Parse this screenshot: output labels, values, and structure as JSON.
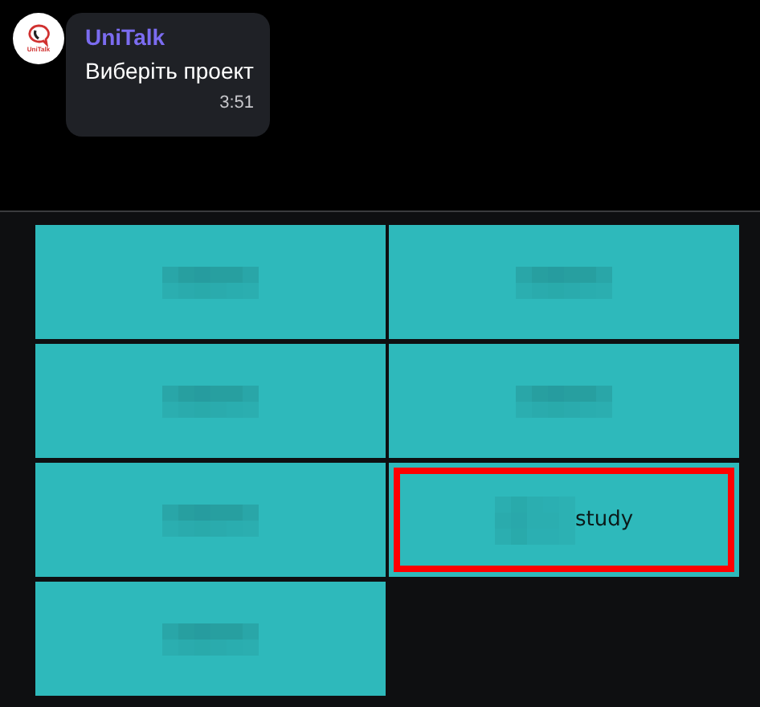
{
  "message": {
    "avatar": {
      "logo_text": "UniTalk"
    },
    "sender": "UniTalk",
    "text": "Виберіть проект",
    "time": "3:51"
  },
  "buttons": [
    {
      "kind": "redacted",
      "highlighted": false
    },
    {
      "kind": "redacted",
      "highlighted": false
    },
    {
      "kind": "redacted",
      "highlighted": false
    },
    {
      "kind": "redacted",
      "highlighted": false
    },
    {
      "kind": "redacted",
      "highlighted": false
    },
    {
      "kind": "partly_redacted",
      "label": "study",
      "highlighted": true
    },
    {
      "kind": "redacted",
      "highlighted": false
    }
  ]
}
